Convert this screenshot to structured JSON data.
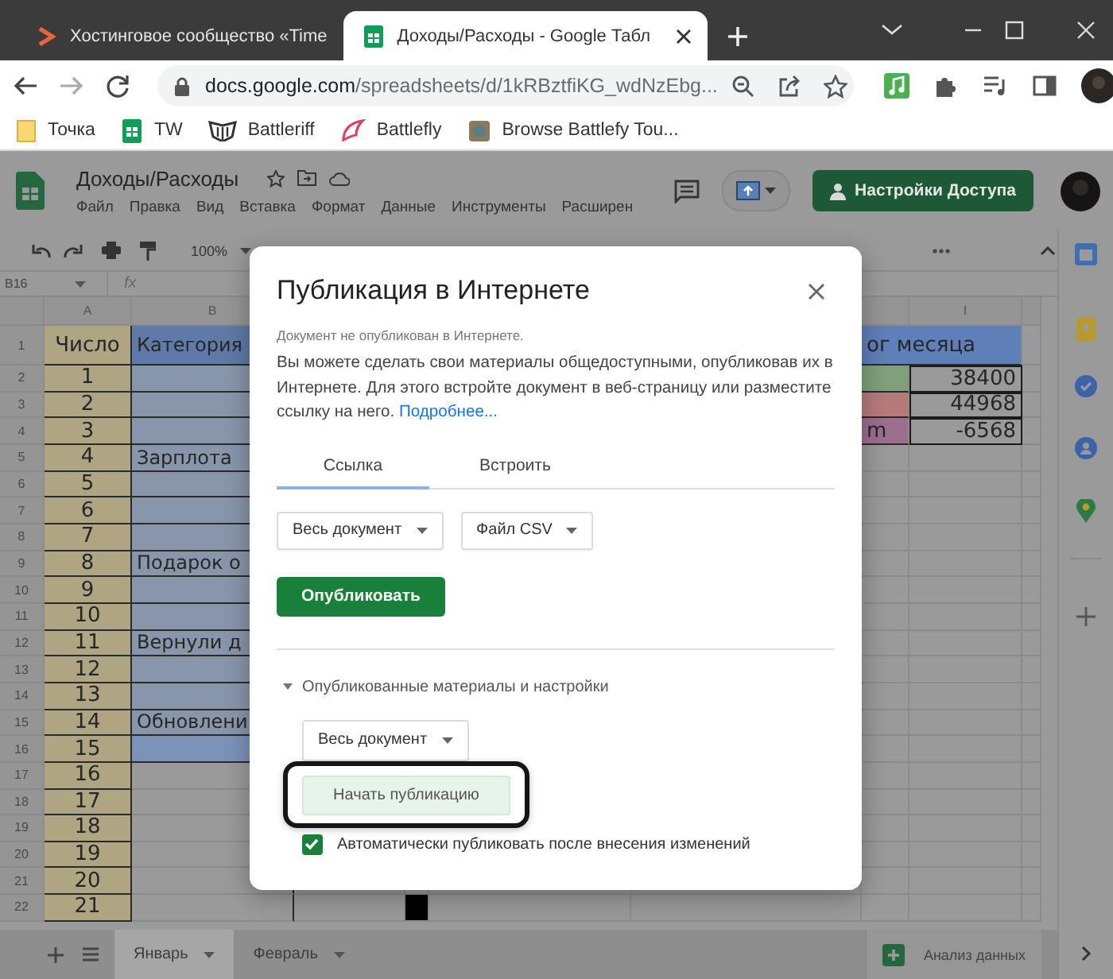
{
  "browser": {
    "tabs": [
      {
        "title": "Хостинговое сообщество «Time",
        "selected": false
      },
      {
        "title": "Доходы/Расходы - Google Табл",
        "selected": true
      }
    ],
    "address": {
      "host": "docs.google.com",
      "path": "/spreadsheets/d/1kRBztfiKG_wdNzEbg..."
    },
    "bookmarks": [
      {
        "label": "Точка"
      },
      {
        "label": "TW"
      },
      {
        "label": "Battleriff"
      },
      {
        "label": "Battlefly"
      },
      {
        "label": "Browse Battlefy Tou..."
      }
    ]
  },
  "sheets": {
    "title": "Доходы/Расходы",
    "menu": [
      "Файл",
      "Правка",
      "Вид",
      "Вставка",
      "Формат",
      "Данные",
      "Инструменты",
      "Расширен"
    ],
    "share_button": "Настройки Доступа",
    "zoom": "100%",
    "name_box": "B16",
    "formula_label": "fx",
    "column_headers": [
      "A",
      "B",
      "I"
    ],
    "rows": [
      {
        "number": "1",
        "A": {
          "text": "Число"
        },
        "B": {
          "text": "Категория",
          "color": "#5d7ba6"
        },
        "color_cell": {
          "text": "ог месяца",
          "color": "#5f7fb8",
          "merged": true
        }
      },
      {
        "number": "2",
        "A": {
          "text": "1"
        },
        "B": {
          "color": "#8896aa"
        },
        "color_cell": {
          "color": "#7fa07a"
        },
        "I": {
          "text": "38400"
        }
      },
      {
        "number": "3",
        "A": {
          "text": "2"
        },
        "B": {
          "color": "#8896aa"
        },
        "color_cell": {
          "color": "#b57b7b"
        },
        "I": {
          "text": "44968"
        }
      },
      {
        "number": "4",
        "A": {
          "text": "3"
        },
        "B": {
          "color": "#8896aa"
        },
        "color_cell": {
          "text": "m",
          "color": "#9c6f90"
        },
        "I": {
          "text": "-6568"
        }
      },
      {
        "number": "5",
        "A": {
          "text": "4"
        },
        "B": {
          "text": "Зарплота",
          "color": "#8896aa"
        }
      },
      {
        "number": "6",
        "A": {
          "text": "5"
        },
        "B": {
          "color": "#8896aa"
        }
      },
      {
        "number": "7",
        "A": {
          "text": "6"
        },
        "B": {
          "color": "#8896aa"
        }
      },
      {
        "number": "8",
        "A": {
          "text": "7"
        },
        "B": {
          "color": "#8896aa"
        }
      },
      {
        "number": "9",
        "A": {
          "text": "8"
        },
        "B": {
          "text": "Подарок о",
          "color": "#8896aa"
        }
      },
      {
        "number": "10",
        "A": {
          "text": "9"
        },
        "B": {
          "color": "#8896aa"
        }
      },
      {
        "number": "11",
        "A": {
          "text": "10"
        },
        "B": {
          "color": "#8896aa"
        }
      },
      {
        "number": "12",
        "A": {
          "text": "11"
        },
        "B": {
          "text": "Вернули д",
          "color": "#8896aa"
        }
      },
      {
        "number": "13",
        "A": {
          "text": "12"
        },
        "B": {
          "color": "#8896aa"
        }
      },
      {
        "number": "14",
        "A": {
          "text": "13"
        },
        "B": {
          "color": "#8896aa"
        }
      },
      {
        "number": "15",
        "A": {
          "text": "14"
        },
        "B": {
          "text": "Обновлени",
          "color": "#8896aa"
        }
      },
      {
        "number": "16",
        "A": {
          "text": "15"
        },
        "B": {
          "color": "#7b93b8"
        }
      },
      {
        "number": "17",
        "A": {
          "text": "16"
        }
      },
      {
        "number": "18",
        "A": {
          "text": "17"
        }
      },
      {
        "number": "19",
        "A": {
          "text": "18"
        }
      },
      {
        "number": "20",
        "A": {
          "text": "19"
        }
      },
      {
        "number": "21",
        "A": {
          "text": "20"
        }
      },
      {
        "number": "22",
        "A": {
          "text": "21"
        },
        "dark_cell": {
          "color": "#000000"
        }
      }
    ],
    "sheet_tabs": [
      {
        "label": "Январь",
        "selected": true
      },
      {
        "label": "Февраль",
        "selected": false
      }
    ],
    "explore_button": "Анализ данных"
  },
  "dialog": {
    "title": "Публикация в Интернете",
    "status": "Документ не опубликован в Интернете.",
    "description": "Вы можете сделать свои материалы общедоступными, опубликовав их в Интернете. Для этого встройте документ в веб-страницу или разместите ссылку на него.",
    "learn_more_link": "Подробнее...",
    "tabs": [
      {
        "label": "Ссылка",
        "selected": true
      },
      {
        "label": "Встроить",
        "selected": false
      }
    ],
    "dropdowns": [
      "Весь документ",
      "Файл CSV"
    ],
    "publish_button": "Опубликовать",
    "published_section": {
      "label": "Опубликованные материалы и настройки",
      "expanded": true,
      "dropdown": "Весь документ",
      "start_button": "Начать публикацию",
      "auto_publish": {
        "label": "Автоматически публиковать после внесения изменений",
        "checked": true
      }
    }
  }
}
